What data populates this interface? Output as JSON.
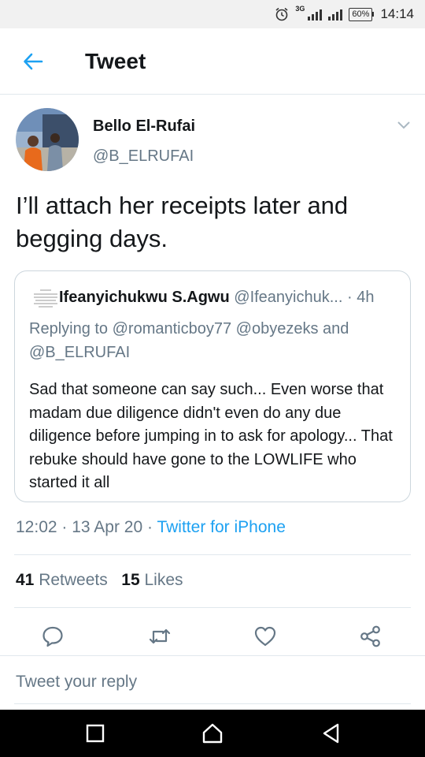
{
  "status_bar": {
    "network": "3G",
    "battery": "60%",
    "time": "14:14"
  },
  "header": {
    "title": "Tweet"
  },
  "tweet": {
    "author_name": "Bello El-Rufai",
    "author_handle": "@B_ELRUFAI",
    "text": "I’ll attach her receipts later and begging days.",
    "time": "12:02",
    "date": "13 Apr 20",
    "source": "Twitter for iPhone",
    "sep": "·"
  },
  "quoted_tweet": {
    "author_name": "Ifeanyichukwu S.Agwu",
    "author_handle": "@Ifeanyichuk...",
    "age": "4h",
    "replying_label": "Replying to",
    "replying_to": [
      "@romanticboy77",
      "@obyezeks",
      "@B_ELRUFAI"
    ],
    "and": "and",
    "text": "Sad that someone can say such... Even worse that madam due diligence didn't even do any due diligence before jumping in to ask for apology... That rebuke should have gone to the LOWLIFE who started it all"
  },
  "stats": {
    "retweets_count": "41",
    "retweets_label": "Retweets",
    "likes_count": "15",
    "likes_label": "Likes"
  },
  "actions": [
    "reply-icon",
    "retweet-icon",
    "like-icon",
    "share-icon"
  ],
  "reply": {
    "placeholder": "Tweet your reply"
  },
  "colors": {
    "accent": "#1da1f2",
    "muted": "#657786",
    "border": "#e1e8ed",
    "text": "#14171a"
  }
}
